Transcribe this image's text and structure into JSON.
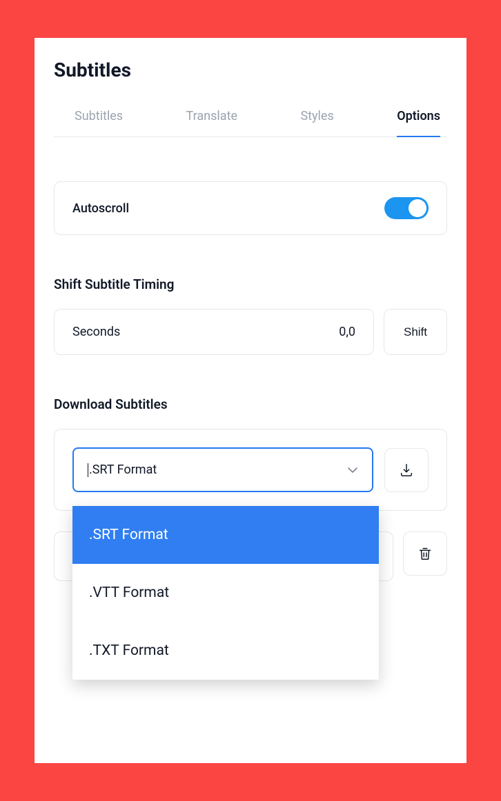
{
  "title": "Subtitles",
  "tabs": [
    {
      "label": "Subtitles",
      "active": false
    },
    {
      "label": "Translate",
      "active": false
    },
    {
      "label": "Styles",
      "active": false
    },
    {
      "label": "Options",
      "active": true
    }
  ],
  "autoscroll": {
    "label": "Autoscroll",
    "on": true
  },
  "shift": {
    "section_title": "Shift Subtitle Timing",
    "field_label": "Seconds",
    "value": "0,0",
    "button": "Shift"
  },
  "download": {
    "section_title": "Download Subtitles",
    "selected": ".SRT Format",
    "options": [
      ".SRT Format",
      ".VTT Format",
      ".TXT Format"
    ]
  }
}
